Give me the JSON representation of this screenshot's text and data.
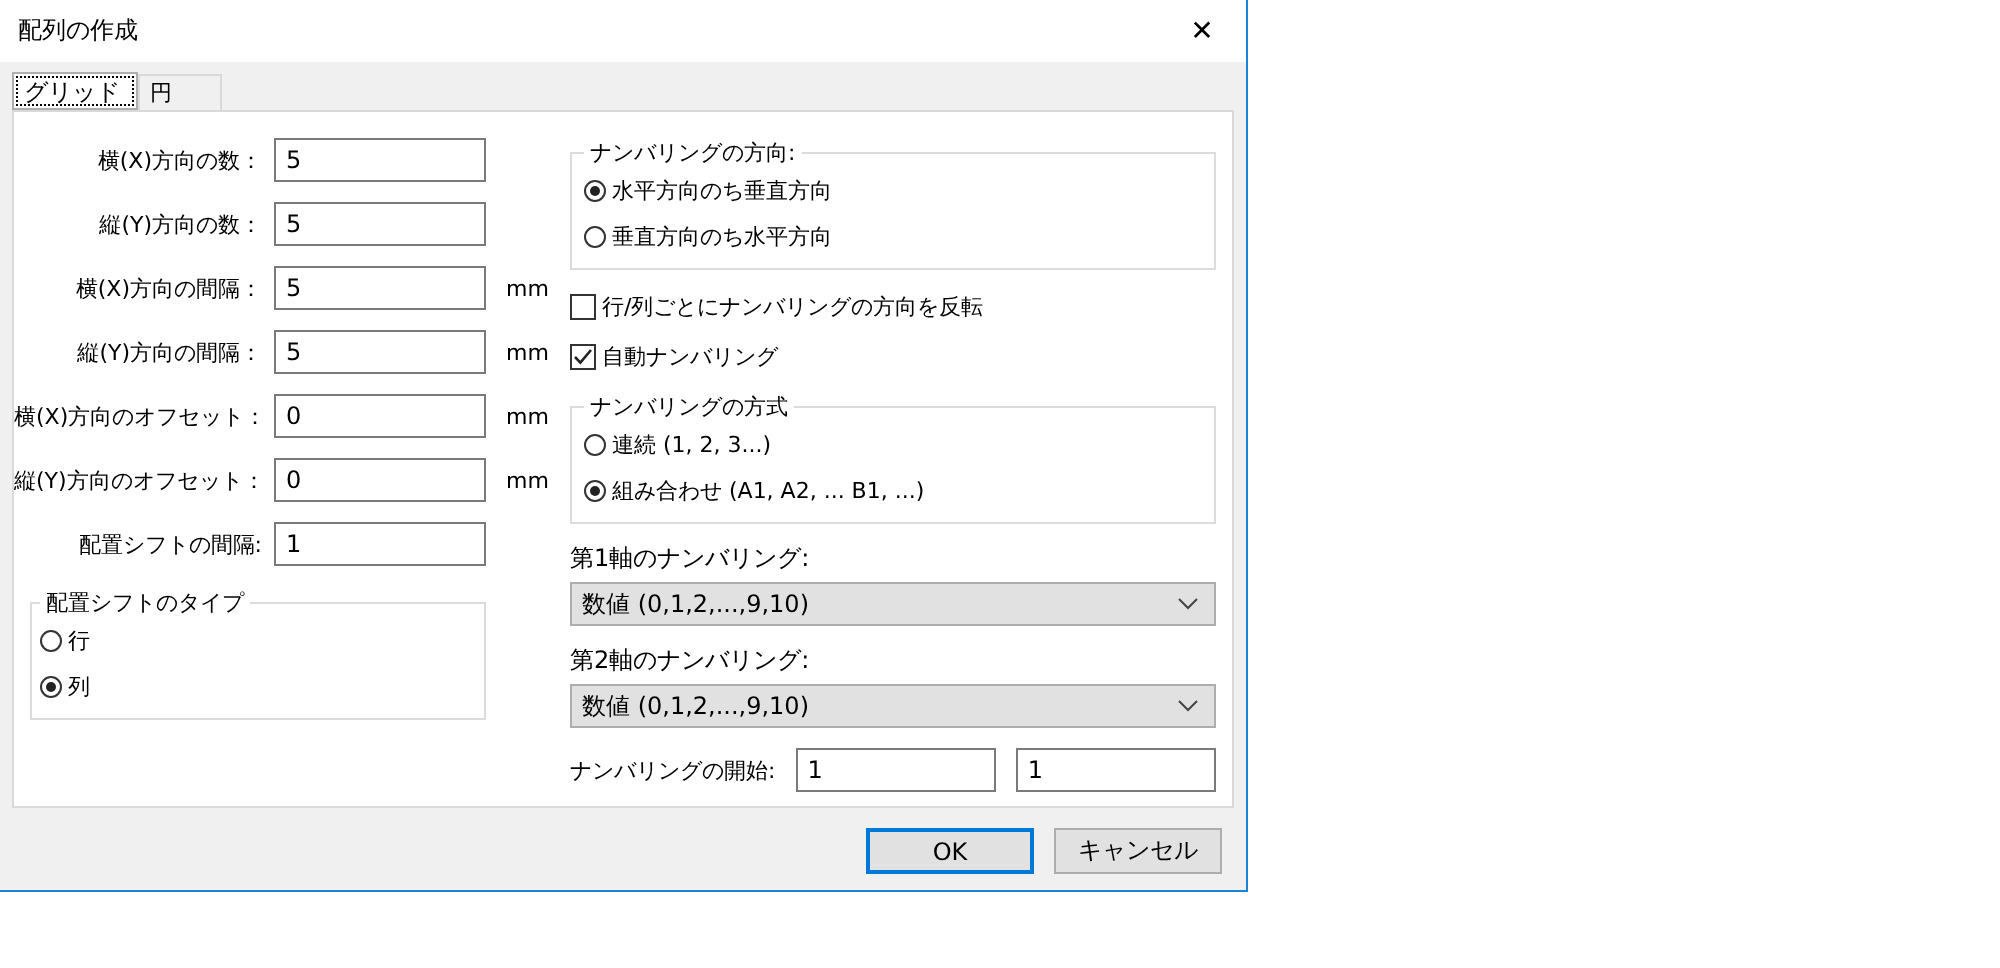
{
  "window": {
    "title": "配列の作成",
    "close": "✕"
  },
  "tabs": [
    {
      "label": "グリッド",
      "selected": true
    },
    {
      "label": "円",
      "selected": false
    }
  ],
  "fields": [
    {
      "label": "横(X)方向の数：",
      "value": "5"
    },
    {
      "label": "縦(Y)方向の数：",
      "value": "5"
    },
    {
      "label": "横(X)方向の間隔：",
      "value": "5",
      "unit": "mm"
    },
    {
      "label": "縦(Y)方向の間隔：",
      "value": "5",
      "unit": "mm"
    },
    {
      "label": "横(X)方向のオフセット：",
      "value": "0",
      "unit": "mm"
    },
    {
      "label": "縦(Y)方向のオフセット：",
      "value": "0",
      "unit": "mm"
    },
    {
      "label": "配置シフトの間隔:",
      "value": "1"
    }
  ],
  "shift_type": {
    "title": "配置シフトのタイプ",
    "options": [
      {
        "label": "行",
        "selected": false
      },
      {
        "label": "列",
        "selected": true
      }
    ]
  },
  "numbering_direction": {
    "title": "ナンバリングの方向:",
    "options": [
      {
        "label": "水平方向のち垂直方向",
        "selected": true
      },
      {
        "label": "垂直方向のち水平方向",
        "selected": false
      }
    ]
  },
  "checkboxes": [
    {
      "label": "行/列ごとにナンバリングの方向を反転",
      "checked": false
    },
    {
      "label": "自動ナンバリング",
      "checked": true
    }
  ],
  "numbering_style": {
    "title": "ナンバリングの方式",
    "options": [
      {
        "label": "連続 (1, 2, 3...)",
        "selected": false
      },
      {
        "label": "組み合わせ (A1, A2, ... B1, ...)",
        "selected": true
      }
    ]
  },
  "axes": [
    {
      "label": "第1軸のナンバリング:",
      "value": "数値 (0,1,2,...,9,10)"
    },
    {
      "label": "第2軸のナンバリング:",
      "value": "数値 (0,1,2,...,9,10)"
    }
  ],
  "numbering_start": {
    "label": "ナンバリングの開始:",
    "values": [
      "1",
      "1"
    ]
  },
  "buttons": [
    {
      "label": "OK",
      "default": true
    },
    {
      "label": "キャンセル",
      "default": false
    }
  ]
}
